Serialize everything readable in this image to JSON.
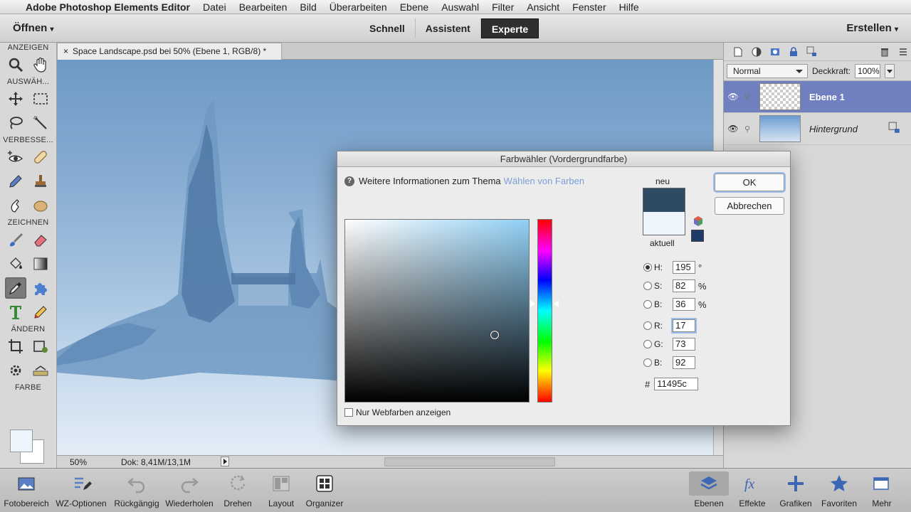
{
  "menubar": {
    "app_name": "Adobe Photoshop Elements Editor",
    "items": [
      "Datei",
      "Bearbeiten",
      "Bild",
      "Überarbeiten",
      "Ebene",
      "Auswahl",
      "Filter",
      "Ansicht",
      "Fenster",
      "Hilfe"
    ]
  },
  "topbar": {
    "open_label": "Öffnen",
    "modes": [
      "Schnell",
      "Assistent",
      "Experte"
    ],
    "active_mode": "Experte",
    "create_label": "Erstellen"
  },
  "tools": {
    "sections": [
      "ANZEIGEN",
      "AUSWÄH...",
      "VERBESSE...",
      "ZEICHNEN",
      "ÄNDERN",
      "FARBE"
    ]
  },
  "document": {
    "tab_title": "Space Landscape.psd bei 50% (Ebene 1, RGB/8) *",
    "zoom": "50%",
    "doc_size": "Dok: 8,41M/13,1M"
  },
  "layers_panel": {
    "blend_mode": "Normal",
    "opacity_label": "Deckkraft:",
    "opacity_value": "100%",
    "layers": [
      {
        "name": "Ebene 1",
        "active": true
      },
      {
        "name": "Hintergrund",
        "active": false
      }
    ]
  },
  "bottom_toolbar": {
    "items": [
      "Fotobereich",
      "WZ-Optionen",
      "Rückgängig",
      "Wiederholen",
      "Drehen",
      "Layout",
      "Organizer",
      "Ebenen",
      "Effekte",
      "Grafiken",
      "Favoriten",
      "Mehr"
    ]
  },
  "color_picker": {
    "title": "Farbwähler (Vordergrundfarbe)",
    "info_text": "Weitere Informationen zum Thema",
    "info_link": "Wählen von Farben",
    "new_label": "neu",
    "current_label": "aktuell",
    "ok_label": "OK",
    "cancel_label": "Abbrechen",
    "web_only_label": "Nur Webfarben anzeigen",
    "fields": {
      "h": {
        "label": "H:",
        "value": "195",
        "unit": "°"
      },
      "s": {
        "label": "S:",
        "value": "82",
        "unit": "%"
      },
      "b": {
        "label": "B:",
        "value": "36",
        "unit": "%"
      },
      "r": {
        "label": "R:",
        "value": "17"
      },
      "g": {
        "label": "G:",
        "value": "73"
      },
      "b2": {
        "label": "B:",
        "value": "92"
      }
    },
    "hex_label": "#",
    "hex_value": "11495c",
    "new_color": "#2f4a63",
    "current_color": "#eef4fb",
    "websafe_color": "#1e3a66"
  }
}
